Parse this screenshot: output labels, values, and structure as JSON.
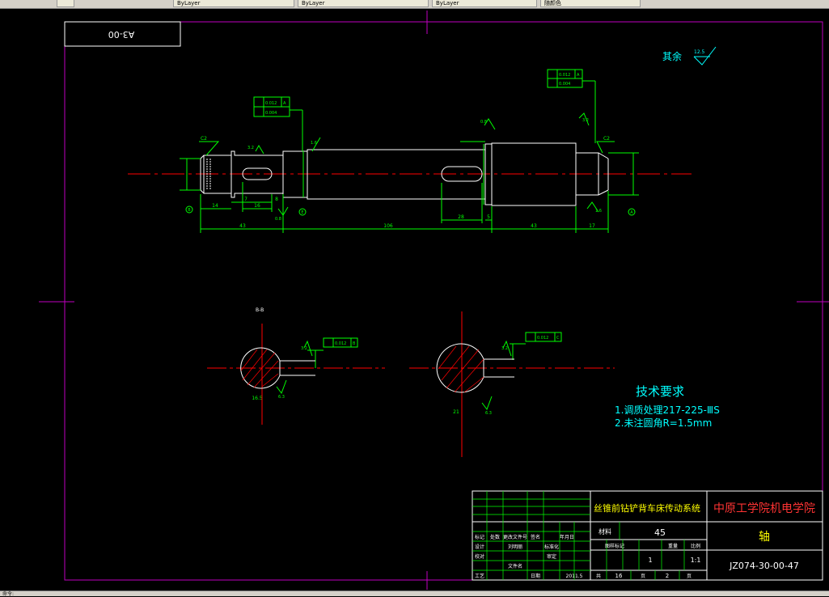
{
  "app": {
    "tabs": [
      "ByLayer",
      "ByLayer",
      "ByLayer",
      "随颜色"
    ],
    "status_text": "命令:"
  },
  "drawing": {
    "sheet_code": "A3-00",
    "surface_note": "其余",
    "roughness_default": "12.5",
    "section_label": "B-B",
    "tech_title": "技术要求",
    "tech_items": [
      "1.调质处理217-225-ⅢS",
      "2.未注圆角R=1.5mm"
    ],
    "dimensions": {
      "overall_left": "43",
      "overall_mid": "106",
      "overall_right": "43",
      "end_right": "17",
      "seg_14": "14",
      "seg_16": "16",
      "seg_7": "7",
      "seg_8": "8",
      "keyway_28": "28",
      "seg_5": "5",
      "chamfer_left": "C2",
      "chamfer_right": "C2",
      "section_left_dim": "16.5",
      "section_right_dim": "21"
    },
    "tolerances": {
      "left_runout": "0.012",
      "left_cyl": "0.004",
      "left_datum": "A",
      "right_runout": "0.012",
      "right_cyl": "0.004",
      "right_datum": "A",
      "sym_left": "0.012",
      "sym_left_datum": "B",
      "sym_right": "0.012",
      "sym_right_datum": "C"
    },
    "roughness_marks": [
      "3.2",
      "1.6",
      "0.8",
      "3.2",
      "0.8",
      "1.6",
      "3.2",
      "3.2",
      "6.3",
      "6.3"
    ],
    "datum_markers": [
      "B",
      "E",
      "A"
    ]
  },
  "title_block": {
    "project": "丝锥前钻铲背车床传动系统",
    "school": "中原工学院机电学院",
    "material_label": "材料",
    "material": "45",
    "part_name": "轴",
    "drawing_no": "JZ074-30-00-47",
    "scale": "1:1",
    "quantity": "1",
    "date": "2011.5",
    "sheets_total": "16",
    "sheet_no": "2",
    "labels": {
      "mark": "标记",
      "count": "处数",
      "change_doc": "更改文件号",
      "sign": "签名",
      "date_hdr": "年月日",
      "design": "设计",
      "standard": "标准化",
      "check": "校对",
      "review": "审定",
      "process": "工艺",
      "approve": "日期",
      "stage_mark": "图样标记",
      "weight": "重量",
      "scale_lbl": "比例",
      "total": "共",
      "sheet_unit": "页",
      "page": "第",
      "page_unit": "页",
      "designer": "刘明丽",
      "batch": "文件名"
    }
  }
}
